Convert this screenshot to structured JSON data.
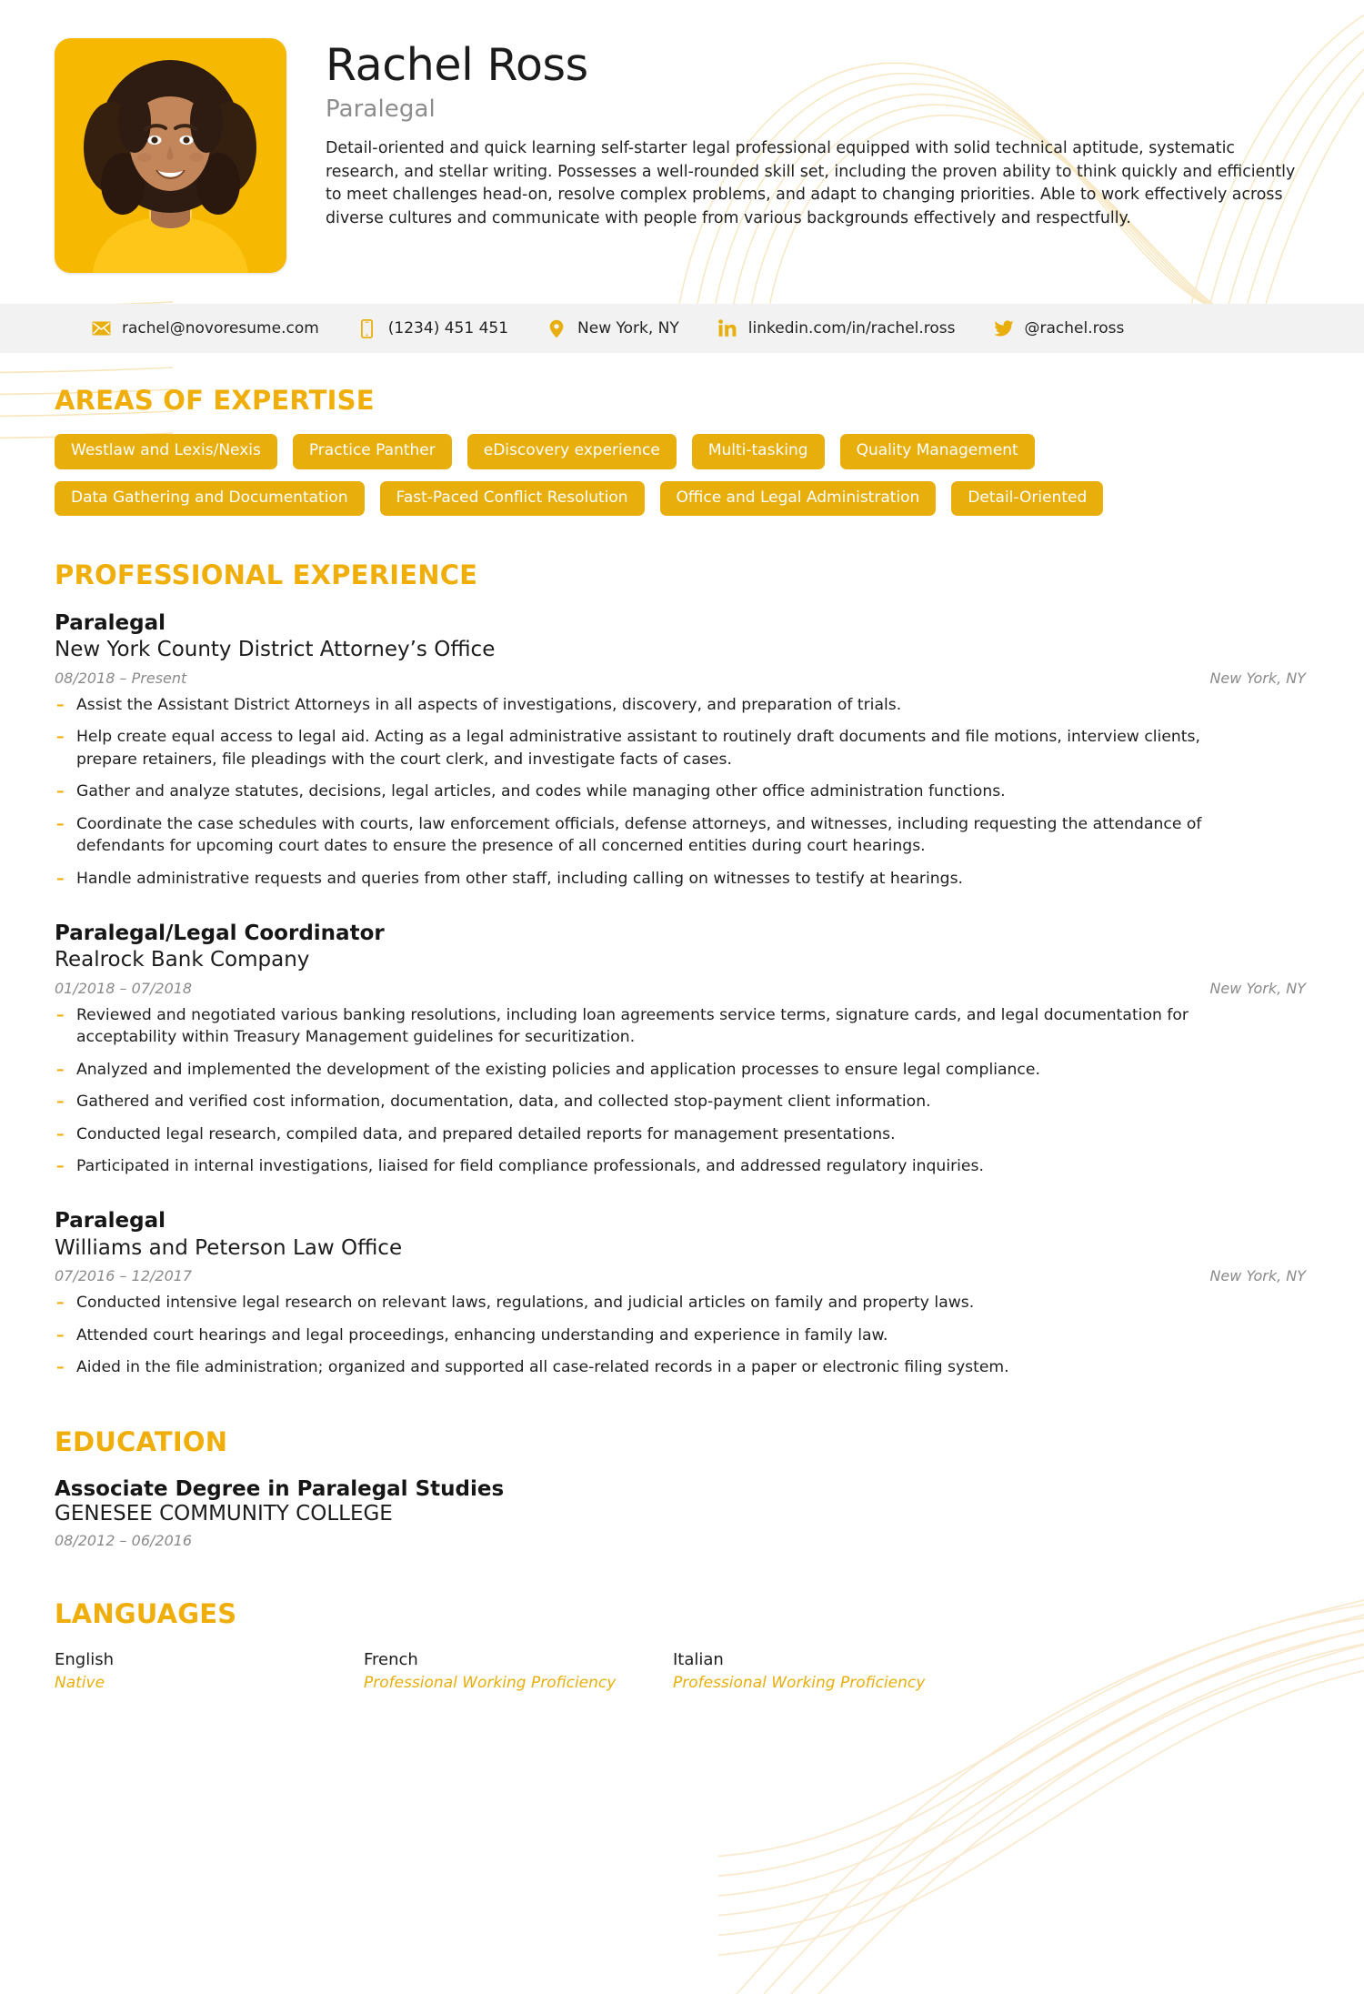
{
  "header": {
    "full_name": "Rachel Ross",
    "job_title": "Paralegal",
    "summary": "Detail-oriented and quick learning self-starter legal professional equipped with solid technical aptitude, systematic research, and stellar writing. Possesses a well-rounded skill set, including the proven ability to think quickly and efficiently to meet challenges head-on, resolve complex problems, and adapt to changing priorities. Able to work effectively across diverse cultures and communicate with people from various backgrounds effectively and respectfully.",
    "photo_alt": "portrait-photo"
  },
  "contact": [
    {
      "icon": "envelope-icon",
      "name": "email",
      "value": "rachel@novoresume.com"
    },
    {
      "icon": "phone-icon",
      "name": "phone",
      "value": "(1234) 451 451"
    },
    {
      "icon": "location-pin-icon",
      "name": "location",
      "value": "New York, NY"
    },
    {
      "icon": "linkedin-icon",
      "name": "linkedin",
      "value": "linkedin.com/in/rachel.ross"
    },
    {
      "icon": "twitter-icon",
      "name": "twitter",
      "value": "@rachel.ross"
    }
  ],
  "sections": {
    "areas_title": "AREAS OF EXPERTISE",
    "experience_title": "PROFESSIONAL EXPERIENCE",
    "education_title": "EDUCATION",
    "languages_title": "LANGUAGES"
  },
  "skills": [
    "Westlaw and Lexis/Nexis",
    "Practice Panther",
    "eDiscovery experience",
    "Multi-tasking",
    "Quality Management",
    "Data Gathering and Documentation",
    "Fast-Paced Conflict Resolution",
    "Office and Legal Administration",
    "Detail-Oriented"
  ],
  "experience": [
    {
      "role": "Paralegal",
      "company": "New York County District Attorney’s Office",
      "dates": "08/2018 – Present",
      "location": "New York, NY",
      "bullets": [
        "Assist the Assistant District Attorneys in all aspects of investigations, discovery, and preparation of trials.",
        "Help create equal access to legal aid. Acting as a legal administrative assistant to routinely draft documents and file motions, interview clients, prepare retainers, file pleadings with the court clerk, and investigate facts of cases.",
        "Gather and analyze statutes, decisions, legal articles, and codes while managing other office administration functions.",
        "Coordinate the case schedules with courts, law enforcement officials, defense attorneys, and witnesses, including requesting the attendance of defendants for upcoming court dates to ensure the presence of all concerned entities during court hearings.",
        "Handle administrative requests and queries from other staff, including calling on witnesses to testify at hearings."
      ]
    },
    {
      "role": "Paralegal/Legal Coordinator",
      "company": "Realrock Bank Company",
      "dates": "01/2018 – 07/2018",
      "location": "New York, NY",
      "bullets": [
        "Reviewed and negotiated various banking resolutions, including loan agreements service terms, signature cards, and legal documentation for acceptability within Treasury Management guidelines for securitization.",
        "Analyzed and implemented the development of the existing policies and application processes to ensure legal compliance.",
        "Gathered and verified cost information, documentation, data, and collected stop-payment client information.",
        "Conducted legal research, compiled data, and prepared detailed reports for management presentations.",
        "Participated in internal investigations, liaised for field compliance professionals, and addressed regulatory inquiries."
      ]
    },
    {
      "role": "Paralegal",
      "company": "Williams and Peterson Law Office",
      "dates": "07/2016 – 12/2017",
      "location": "New York, NY",
      "bullets": [
        "Conducted intensive legal research on relevant laws, regulations, and judicial articles on family and property laws.",
        "Attended court hearings and legal proceedings, enhancing understanding and experience in family law.",
        "Aided in the file administration; organized and supported all case-related records in a paper or electronic filing system."
      ]
    }
  ],
  "education": [
    {
      "degree": "Associate Degree in Paralegal Studies",
      "school": "GENESEE COMMUNITY COLLEGE",
      "dates": "08/2012 – 06/2016"
    }
  ],
  "languages": [
    {
      "name": "English",
      "level": "Native"
    },
    {
      "name": "French",
      "level": "Professional Working Proficiency"
    },
    {
      "name": "Italian",
      "level": "Professional Working Proficiency"
    }
  ],
  "colors": {
    "accent": "#E8AE0C",
    "accent_heading": "#F0AE0B",
    "photo_bg": "#F6B800",
    "contact_bar_bg": "#f2f2f2",
    "muted_text": "#8a8a8a",
    "deco_line": "#f7e6bd"
  }
}
